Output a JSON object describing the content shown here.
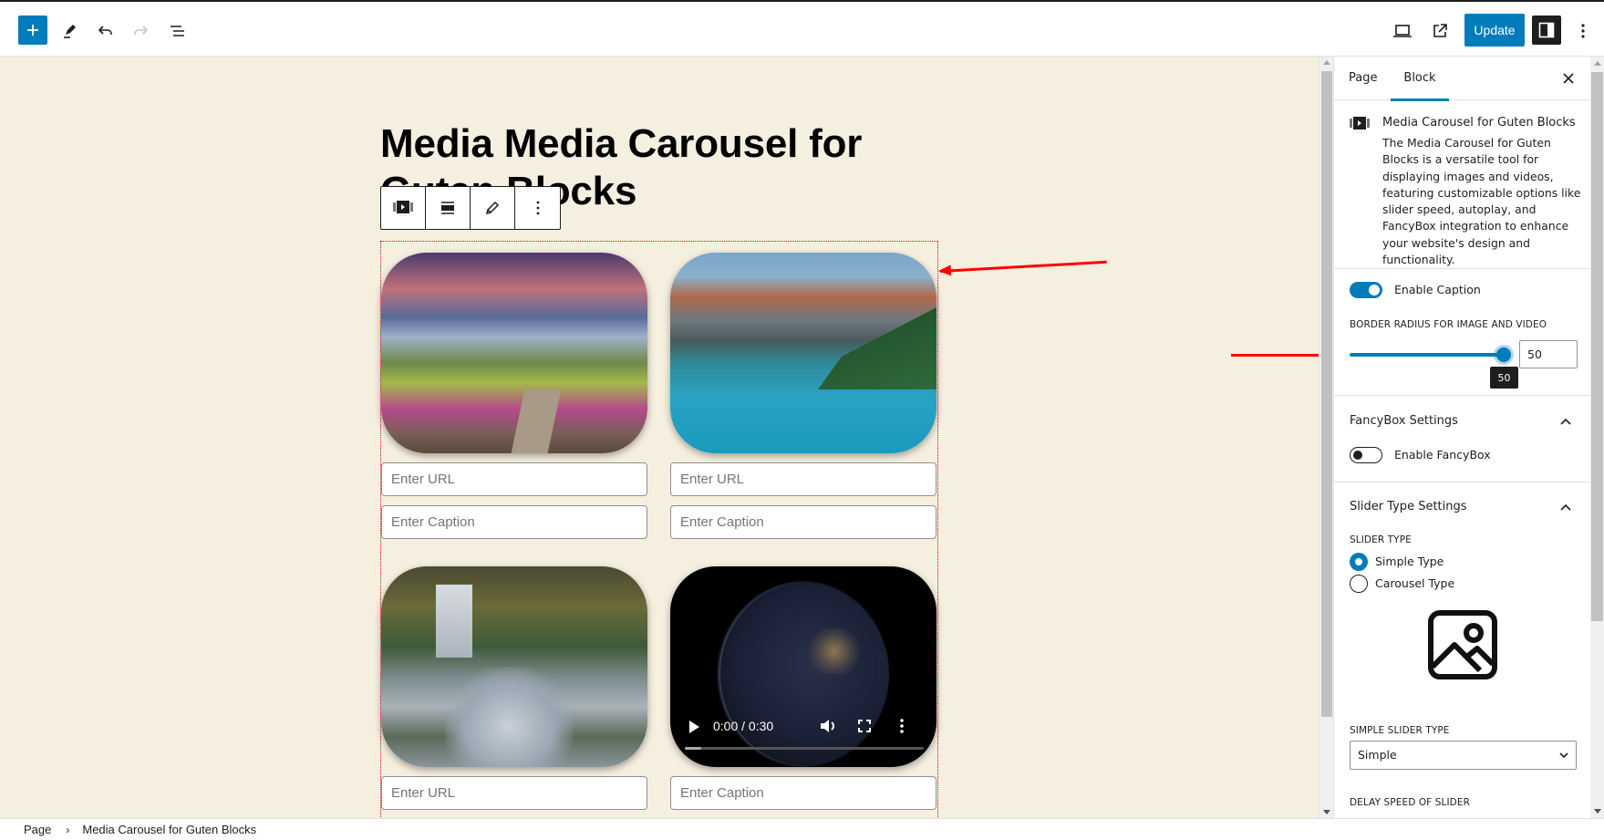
{
  "header": {
    "icons": {
      "add": "plus-icon",
      "tools": "pencil-icon",
      "undo": "undo-icon",
      "redo": "redo-icon",
      "document_overview": "list-view-icon",
      "preview": "laptop-icon",
      "view_page": "external-link-icon",
      "settings": "sidebar-toggle-icon",
      "options": "more-vertical-icon"
    },
    "update_label": "Update",
    "accent_color": "#007cba"
  },
  "canvas": {
    "background_color": "#f5efe0",
    "title": "Media Media Carousel for Guten Blocks",
    "block_toolbar": {
      "icons": [
        "media-carousel-block-icon",
        "align-icon",
        "edit-pencil-icon",
        "more-vertical-icon"
      ]
    },
    "items": [
      {
        "type": "image",
        "subject": "mountain meadow with flowers at sunset",
        "url_placeholder": "Enter URL",
        "caption_placeholder": "Enter Caption"
      },
      {
        "type": "image",
        "subject": "mountain lake with reflections",
        "url_placeholder": "Enter URL",
        "caption_placeholder": "Enter Caption"
      },
      {
        "type": "image",
        "subject": "forest waterfall stream",
        "url_placeholder": "Enter URL"
      },
      {
        "type": "video",
        "subject": "earth at night from space",
        "time": "0:00 / 0:30",
        "progress": 0.07,
        "caption_placeholder": "Enter Caption"
      }
    ],
    "annotation_color": "#ff0000"
  },
  "footer": {
    "breadcrumb": [
      "Page",
      "Media Carousel for Guten Blocks"
    ],
    "separator": "›"
  },
  "sidebar": {
    "tabs": [
      {
        "label": "Page",
        "active": false
      },
      {
        "label": "Block",
        "active": true
      }
    ],
    "block_card": {
      "title": "Media Carousel for Guten Blocks",
      "description": "The Media Carousel for Guten Blocks is a versatile tool for displaying images and videos, featuring customizable options like slider speed, autoplay, and FancyBox integration to enhance your website's design and functionality."
    },
    "enable_caption": {
      "label": "Enable Caption",
      "checked": true
    },
    "border_radius": {
      "label": "Border Radius for Image and Video",
      "value": "50",
      "tooltip": "50",
      "fraction": 1.0
    },
    "fancybox": {
      "title": "FancyBox Settings",
      "enable": {
        "label": "Enable FancyBox",
        "checked": false
      }
    },
    "slider_type": {
      "title": "Slider Type Settings",
      "label": "Slider Type",
      "options": [
        {
          "label": "Simple Type",
          "checked": true
        },
        {
          "label": "Carousel Type",
          "checked": false
        }
      ],
      "preview_icon": "image-icon"
    },
    "simple_slider_type": {
      "label": "Simple Slider Type",
      "value": "Simple"
    },
    "delay_speed": {
      "label": "Delay Speed of Slider"
    }
  }
}
